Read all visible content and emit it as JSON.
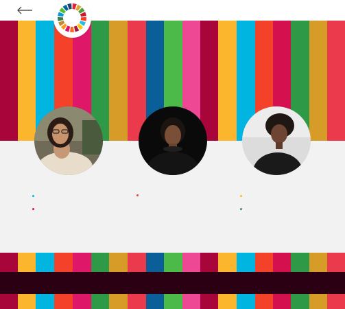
{
  "header": {
    "back_icon": "arrow-left-icon",
    "logo_icon": "sdg-color-wheel-icon"
  },
  "sdg_colors": [
    "#a8063a",
    "#fcb62d",
    "#00b5e0",
    "#f3412a",
    "#de1768",
    "#2e9a48",
    "#d79c28",
    "#eb3a4b",
    "#0b5f99",
    "#4bba48",
    "#ee4794",
    "#a8063a",
    "#fcb62d",
    "#00b5e0",
    "#f3412a",
    "#d4114e",
    "#2e9a48",
    "#d79c28",
    "#eb3a4b"
  ],
  "profiles": [
    {
      "photo": "avatar-photo-1",
      "bullet_colors": [
        "#00b5e0",
        "#d4114e"
      ]
    },
    {
      "photo": "avatar-photo-2",
      "bullet_colors": [
        "#eb3a4b"
      ]
    },
    {
      "photo": "avatar-photo-3",
      "bullet_colors": [
        "#fcb62d",
        "#2e9a48"
      ]
    }
  ]
}
